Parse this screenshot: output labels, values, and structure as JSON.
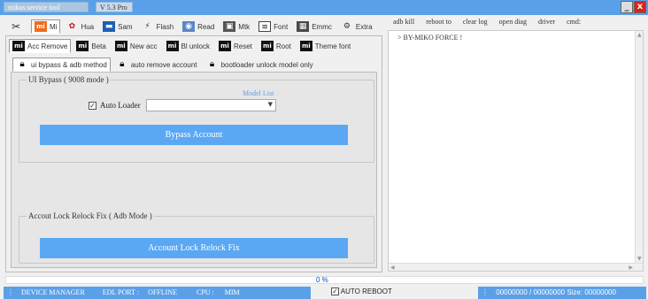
{
  "window": {
    "title": "mikos service tool",
    "version": "V 5.3 Pro",
    "minimize": "_",
    "close": "x"
  },
  "top_tabs": [
    {
      "label": "",
      "icon": "tools-icon"
    },
    {
      "label": "Mi",
      "icon": "xiaomi-icon",
      "selected": true
    },
    {
      "label": "Hua",
      "icon": "huawei-icon"
    },
    {
      "label": "Sam",
      "icon": "samsung-icon"
    },
    {
      "label": "Flash",
      "icon": "flash-icon"
    },
    {
      "label": "Read",
      "icon": "read-icon"
    },
    {
      "label": "Mtk",
      "icon": "mtk-chip-icon"
    },
    {
      "label": "Font",
      "icon": "font-icon"
    },
    {
      "label": "Emmc",
      "icon": "emmc-chip-icon"
    },
    {
      "label": "Extra",
      "icon": "extra-icon"
    }
  ],
  "mi_tabs": [
    {
      "label": "Acc Remove",
      "selected": true
    },
    {
      "label": "Beta"
    },
    {
      "label": "New acc"
    },
    {
      "label": "Bl unlock"
    },
    {
      "label": "Reset"
    },
    {
      "label": "Root"
    },
    {
      "label": "Theme font"
    }
  ],
  "sub_tabs": [
    {
      "label": "ui bypass & adb method",
      "selected": true
    },
    {
      "label": "auto remove account"
    },
    {
      "label": "bootloader unlock model only"
    }
  ],
  "ui_bypass": {
    "group_title": "UI Bypass ( 9008 mode )",
    "model_list_link": "Model List",
    "auto_loader_label": "Auto Loader",
    "auto_loader_checked": true,
    "model_select_value": "",
    "button_label": "Bypass Account"
  },
  "relock": {
    "group_title": "Accout Lock Relock Fix ( Adb Mode )",
    "button_label": "Account Lock Relock Fix"
  },
  "right_menu": [
    "adb kill",
    "reboot to",
    "clear log",
    "open diag",
    "driver",
    "cmd:"
  ],
  "console": {
    "lines": [
      "> BY-MIKO FORCE !"
    ]
  },
  "progress": {
    "value": 0,
    "text": "0  %"
  },
  "statusbar": {
    "device_manager": "DEVICE MANAGER",
    "edl_port_label": "EDL PORT :",
    "edl_port_value": "OFFLINE",
    "cpu_label": "CPU :",
    "cpu_value": "MIM",
    "auto_reboot_label": "AUTO REBOOT",
    "auto_reboot_checked": true,
    "size_text": "00000000 / 00000000 Size: 00000000"
  },
  "colors": {
    "accent": "#5aa8f4",
    "titlebar": "#5aa0e8",
    "close": "#d9241a",
    "xiaomi_orange": "#f26a1b"
  }
}
